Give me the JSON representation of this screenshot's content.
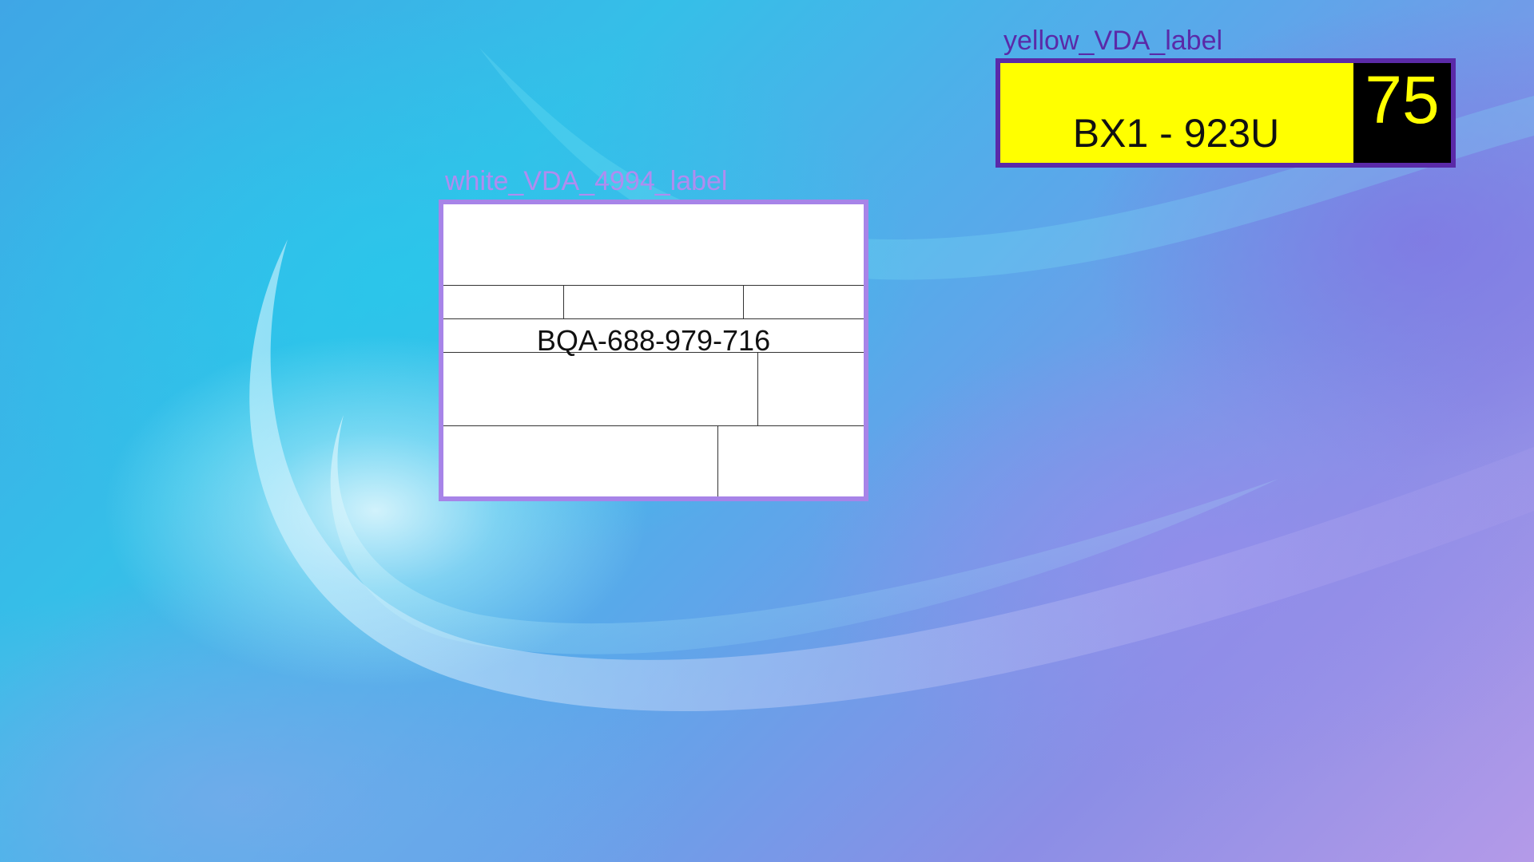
{
  "desktop": {
    "wallpaper": "blue-purple-swirl",
    "colors": {
      "accent_purple": "#5a2aa8",
      "accent_lilac": "#a784e8",
      "label_yellow": "#ffff00",
      "label_black": "#000000"
    }
  },
  "white_label": {
    "caption": "white_VDA_4994_label",
    "code": "BQA-688-979-716"
  },
  "yellow_label": {
    "caption": "yellow_VDA_label",
    "code": "BX1 - 923U",
    "number": "75"
  }
}
